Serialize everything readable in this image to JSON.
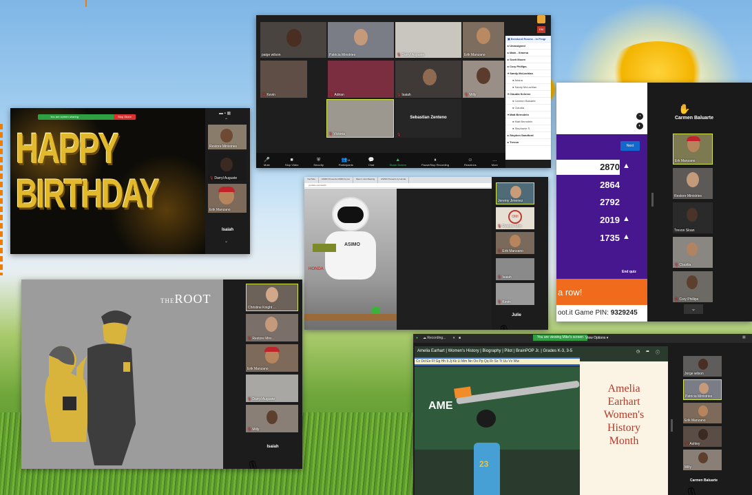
{
  "colors": {
    "accent_orange": "#f07d00",
    "zoom_green": "#2ea043",
    "stop_red": "#d9322f",
    "kahoot_purple": "#46178f",
    "kahoot_orange": "#f06b1c",
    "kahoot_blue": "#1368ce"
  },
  "birthday": {
    "line1": "HAPPY",
    "line2": "BIRTHDAY",
    "share_bar": "You are screen sharing",
    "stop_share": "Stop Share",
    "participants": [
      "Restore Ministries",
      "Darryl Auguste",
      "Erik Manzano"
    ],
    "active_name": "Isaiah"
  },
  "gallery": {
    "tiles": [
      "paige wilson",
      "Patricia Minstries",
      "Darryl Auguste",
      "Erik Manzano",
      "Kevin",
      "Adrian",
      "Isaiah",
      "Milly",
      "Victoria"
    ],
    "center_name": "Sebastian Zenteno",
    "breakout": {
      "title": "Breakout Rooms - In Progr",
      "rows": [
        {
          "type": "grp",
          "label": "Unassigned"
        },
        {
          "type": "grp",
          "label": "Main - Ximena"
        },
        {
          "type": "grp",
          "label": "Scott Moore"
        },
        {
          "type": "grp",
          "label": "Cory Phillips"
        },
        {
          "type": "grp",
          "label": "Sandy McLachlan"
        },
        {
          "type": "mem",
          "label": "Ariana"
        },
        {
          "type": "mem",
          "label": "Sandy McLachlan"
        },
        {
          "type": "grp",
          "label": "Claudia Schreer"
        },
        {
          "type": "mem",
          "label": "Carmen Baluarte"
        },
        {
          "type": "mem",
          "label": "Claudia"
        },
        {
          "type": "grp",
          "label": "Matt Bernstein"
        },
        {
          "type": "mem",
          "label": "Matt Bernstein"
        },
        {
          "type": "mem",
          "label": "Stephanie S"
        },
        {
          "type": "grp",
          "label": "Stephen Sandford"
        },
        {
          "type": "grp",
          "label": "Trevon"
        }
      ]
    },
    "badge": "EM",
    "toolbar": [
      {
        "icon": "🎤",
        "label": "Mute"
      },
      {
        "icon": "■",
        "label": "Stop Video"
      },
      {
        "icon": "⛨",
        "label": "Security"
      },
      {
        "icon": "👥",
        "label": "Participants",
        "count": "11"
      },
      {
        "icon": "💬",
        "label": "Chat"
      },
      {
        "icon": "▲",
        "label": "Share Screen",
        "green": true
      },
      {
        "icon": "⏸",
        "label": "Pause/Stop Recording"
      },
      {
        "icon": "☺",
        "label": "Reactions"
      },
      {
        "icon": "…",
        "label": "More"
      }
    ]
  },
  "kahoot": {
    "next": "Next",
    "scores": [
      {
        "value": "2870",
        "up": true
      },
      {
        "value": "2864",
        "up": false
      },
      {
        "value": "2792",
        "up": false
      },
      {
        "value": "2019",
        "up": true
      },
      {
        "value": "1735",
        "up": true
      }
    ],
    "end_quiz": "End quiz",
    "streak": "a row!",
    "pin_label": "oot.it Game PIN:",
    "pin": "9329245",
    "hand_name": "Carmen Baluarte",
    "participants": [
      "Erk Manzano",
      "Restore Ministries",
      "Trevon Sloan",
      "Claudia",
      "Cory Phillips"
    ]
  },
  "robot": {
    "tabs": [
      "YouTube",
      "ASIMO Presents ASIMO by Ho",
      "Meet 1 Join Meeting",
      "ASIMO Presents by Honda"
    ],
    "url": "youtube.com/watch",
    "brand": "HONDA",
    "chest": "ASIMO",
    "participants": [
      "Jeremy Jimenez",
      "Restore Mini",
      "Erik Manzano",
      "Isaiah",
      "Kevin"
    ],
    "active_name": "Julie"
  },
  "root": {
    "logo_the": "THE",
    "logo_root": "ROOT",
    "participants": [
      "Christine Knight ...",
      "Restore Mini...",
      "Erik Manzano",
      "Darryl Auguste",
      "Milly"
    ],
    "active_name": "Isaiah"
  },
  "amelia": {
    "recording": "Recording...",
    "viewing": "You are viewing Mike's screen",
    "view_options": "View Options",
    "video_title": "Amelia Earhart | Women's History | Biography | Pilot | BrainPOP Jr. | Grades K-3, 3-5",
    "alphabet": "Cc Dd Ee Ff Gg Hh Ii Jj Kk Ll Mm Nn Oo Pp Qq Rr Ss Tt Uu Vv Ww",
    "board_text": "AME",
    "jersey": "23",
    "card_lines": [
      "Amelia",
      "Earhart",
      "Women's",
      "History",
      "Month"
    ],
    "participants": [
      "Jorge wilson",
      "Patricia Ministries",
      "Erik Manzano",
      "Ashley",
      "Milly"
    ],
    "active_name": "Carmen Baluarte"
  }
}
